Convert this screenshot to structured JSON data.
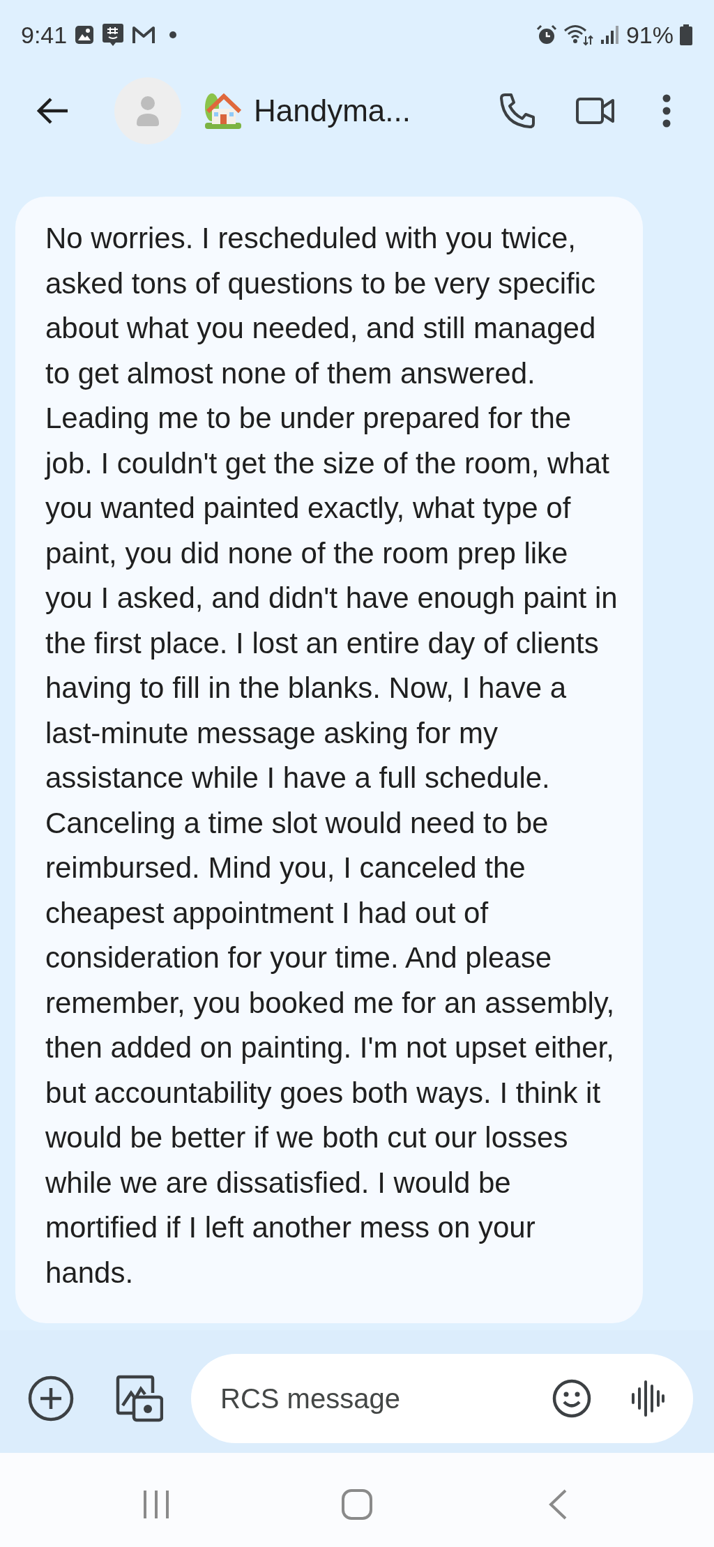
{
  "status_bar": {
    "time": "9:41",
    "battery": "91%"
  },
  "header": {
    "contact_name": "Handyma..."
  },
  "messages": [
    {
      "text": "No worries. I rescheduled with you twice, asked tons of questions to be very specific about what you needed, and still managed to get almost none of them answered. Leading me to be under prepared for the job. I couldn't get the size of the room, what you wanted painted exactly, what type of paint, you did none of the room prep like you I asked, and didn't have enough paint in the first place. I lost an entire day of clients having to fill in the blanks. Now, I have a last-minute message asking for my assistance while I have a full schedule. Canceling a time slot would need to be reimbursed. Mind you, I canceled the cheapest appointment I had out of consideration for your time. And please remember, you booked me for an assembly, then added on painting. I'm not upset either, but accountability goes both ways. I think it would be better if we both cut our losses while we are dissatisfied. I would be mortified if I left another mess on your hands."
    }
  ],
  "composer": {
    "placeholder": "RCS message"
  }
}
